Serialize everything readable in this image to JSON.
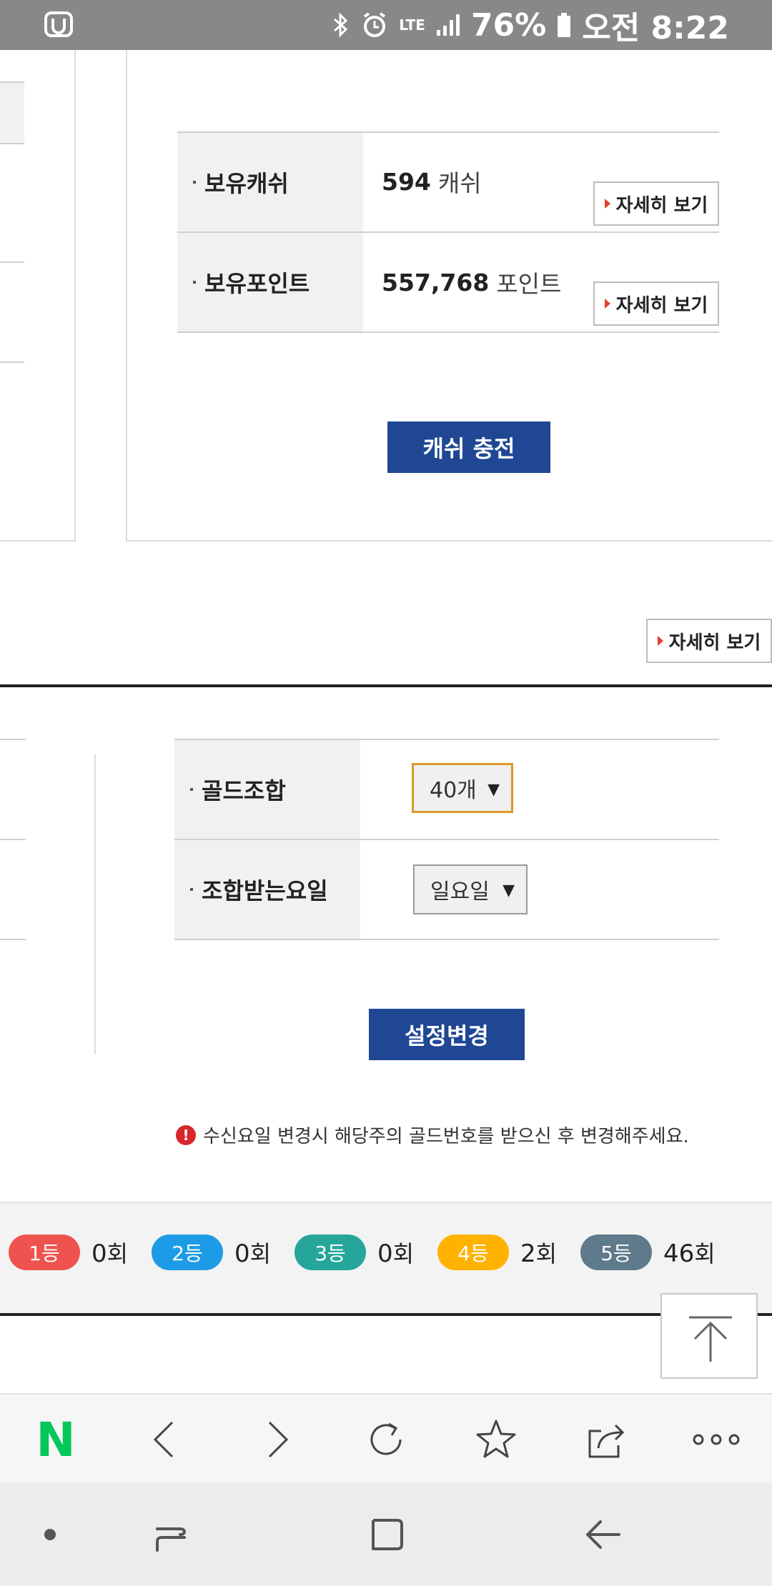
{
  "status_bar": {
    "battery": "76%",
    "time": "오전 8:22",
    "network": "LTE"
  },
  "cash_section": {
    "rows": [
      {
        "label": "보유캐쉬",
        "value": "594",
        "unit": "캐쉬",
        "detail": "자세히 보기"
      },
      {
        "label": "보유포인트",
        "value": "557,768",
        "unit": "포인트",
        "detail": "자세히 보기"
      }
    ],
    "charge_button": "캐쉬 충전"
  },
  "section_detail_button": "자세히 보기",
  "gold_settings": {
    "rows": [
      {
        "label": "골드조합",
        "selected": "40개"
      },
      {
        "label": "조합받는요일",
        "selected": "일요일"
      }
    ],
    "submit_button": "설정변경",
    "notice": "수신요일 변경시 해당주의 골드번호를 받으신 후 변경해주세요."
  },
  "ranks": [
    {
      "label": "1등",
      "count": "0",
      "suffix": "회",
      "color": "#ef5350"
    },
    {
      "label": "2등",
      "count": "0",
      "suffix": "회",
      "color": "#1e9be6"
    },
    {
      "label": "3등",
      "count": "0",
      "suffix": "회",
      "color": "#26a69a"
    },
    {
      "label": "4등",
      "count": "2",
      "suffix": "회",
      "color": "#ffb300"
    },
    {
      "label": "5등",
      "count": "46",
      "suffix": "회",
      "color": "#5f7a8a"
    }
  ],
  "colors": {
    "primary": "#1f4794",
    "naver_green": "#03c75a"
  },
  "browser_toolbar": {
    "icons": [
      "naver-logo",
      "back-icon",
      "forward-icon",
      "refresh-icon",
      "star-icon",
      "share-icon",
      "more-icon"
    ],
    "logo_text": "N"
  },
  "nav_bar": {
    "icons": [
      "dot-icon",
      "recent-apps-icon",
      "home-icon",
      "back-nav-icon"
    ]
  }
}
